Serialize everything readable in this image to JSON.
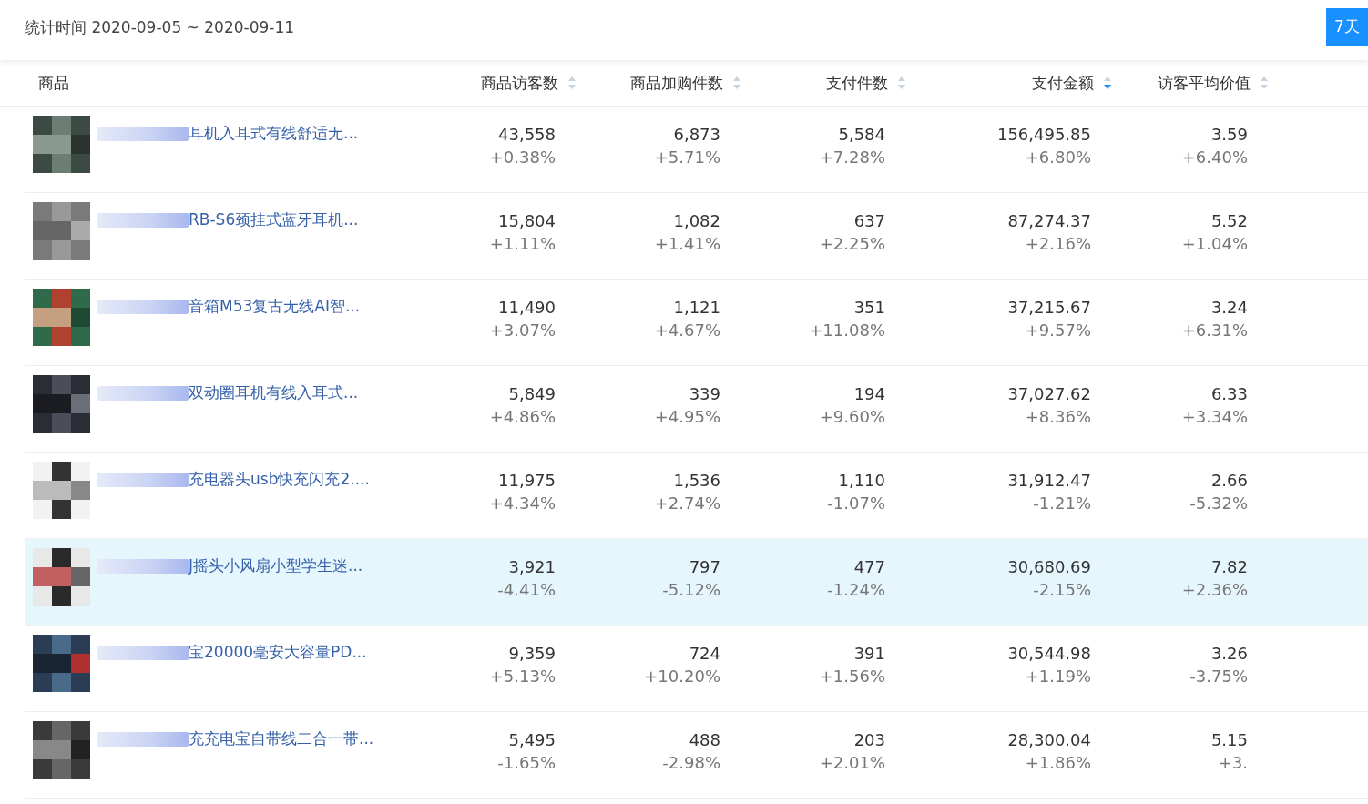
{
  "stats_period": {
    "label": "统计时间",
    "range": "2020-09-05 ~ 2020-09-11"
  },
  "range_button": {
    "label": "7天",
    "selected": true
  },
  "table": {
    "columns": [
      {
        "label": "商品"
      },
      {
        "label": "商品访客数",
        "sorted_descending": false
      },
      {
        "label": "商品加购件数",
        "sorted_descending": false
      },
      {
        "label": "支付件数",
        "sorted_descending": false
      },
      {
        "label": "支付金额",
        "sorted_descending": true
      },
      {
        "label": "访客平均价值",
        "sorted_descending": false
      }
    ],
    "rows": [
      {
        "selected": false,
        "cells": [
          {
            "title": "耳机入耳式有线舒适无..."
          },
          {
            "value": "43,558",
            "change": "+0.38%"
          },
          {
            "value": "6,873",
            "change": "+5.71%"
          },
          {
            "value": "5,584",
            "change": "+7.28%"
          },
          {
            "value": "156,495.85",
            "change": "+6.80%"
          },
          {
            "value": "3.59",
            "change": "+6.40%"
          }
        ]
      },
      {
        "selected": false,
        "cells": [
          {
            "title": "RB-S6颈挂式蓝牙耳机..."
          },
          {
            "value": "15,804",
            "change": "+1.11%"
          },
          {
            "value": "1,082",
            "change": "+1.41%"
          },
          {
            "value": "637",
            "change": "+2.25%"
          },
          {
            "value": "87,274.37",
            "change": "+2.16%"
          },
          {
            "value": "5.52",
            "change": "+1.04%"
          }
        ]
      },
      {
        "selected": false,
        "cells": [
          {
            "title": "音箱M53复古无线AI智..."
          },
          {
            "value": "11,490",
            "change": "+3.07%"
          },
          {
            "value": "1,121",
            "change": "+4.67%"
          },
          {
            "value": "351",
            "change": "+11.08%"
          },
          {
            "value": "37,215.67",
            "change": "+9.57%"
          },
          {
            "value": "3.24",
            "change": "+6.31%"
          }
        ]
      },
      {
        "selected": false,
        "cells": [
          {
            "title": "双动圈耳机有线入耳式..."
          },
          {
            "value": "5,849",
            "change": "+4.86%"
          },
          {
            "value": "339",
            "change": "+4.95%"
          },
          {
            "value": "194",
            "change": "+9.60%"
          },
          {
            "value": "37,027.62",
            "change": "+8.36%"
          },
          {
            "value": "6.33",
            "change": "+3.34%"
          }
        ]
      },
      {
        "selected": false,
        "cells": [
          {
            "title": "充电器头usb快充闪充2...."
          },
          {
            "value": "11,975",
            "change": "+4.34%"
          },
          {
            "value": "1,536",
            "change": "+2.74%"
          },
          {
            "value": "1,110",
            "change": "-1.07%"
          },
          {
            "value": "31,912.47",
            "change": "-1.21%"
          },
          {
            "value": "2.66",
            "change": "-5.32%"
          }
        ]
      },
      {
        "selected": true,
        "cells": [
          {
            "title": "J摇头小风扇小型学生迷..."
          },
          {
            "value": "3,921",
            "change": "-4.41%"
          },
          {
            "value": "797",
            "change": "-5.12%"
          },
          {
            "value": "477",
            "change": "-1.24%"
          },
          {
            "value": "30,680.69",
            "change": "-2.15%"
          },
          {
            "value": "7.82",
            "change": "+2.36%"
          }
        ]
      },
      {
        "selected": false,
        "cells": [
          {
            "title": "宝20000毫安大容量PD..."
          },
          {
            "value": "9,359",
            "change": "+5.13%"
          },
          {
            "value": "724",
            "change": "+10.20%"
          },
          {
            "value": "391",
            "change": "+1.56%"
          },
          {
            "value": "30,544.98",
            "change": "+1.19%"
          },
          {
            "value": "3.26",
            "change": "-3.75%"
          }
        ]
      },
      {
        "selected": false,
        "cells": [
          {
            "title": "充充电宝自带线二合一带..."
          },
          {
            "value": "5,495",
            "change": "-1.65%"
          },
          {
            "value": "488",
            "change": "-2.98%"
          },
          {
            "value": "203",
            "change": "+2.01%"
          },
          {
            "value": "28,300.04",
            "change": "+1.86%"
          },
          {
            "value": "5.15",
            "change": "+3."
          }
        ]
      }
    ]
  }
}
